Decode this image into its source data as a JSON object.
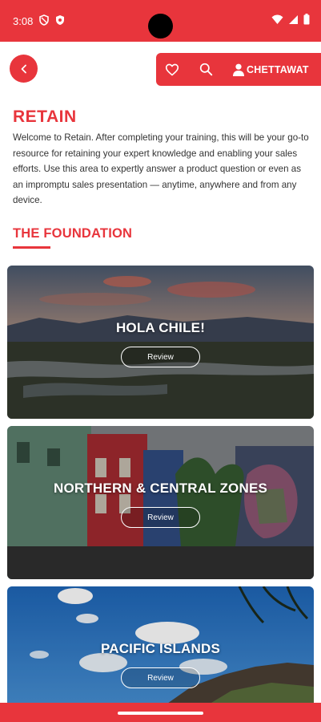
{
  "status": {
    "time": "3:08",
    "left_icons": [
      "shield-icon",
      "shield-check-icon"
    ],
    "right_icons": [
      "wifi-icon",
      "signal-icon",
      "battery-icon"
    ]
  },
  "header": {
    "back_icon": "chevron-left-icon",
    "actions": [
      "heart-icon",
      "search-icon",
      "user-icon"
    ],
    "user_name": "CHETTAWAT"
  },
  "page": {
    "title": "RETAIN",
    "intro": "Welcome to Retain. After completing your training, this will be your go-to resource for retaining your expert knowledge and enabling your sales efforts. Use this area to expertly answer a product question or even as an impromptu sales presentation — anytime, anywhere and from any device."
  },
  "section": {
    "title": "THE FOUNDATION"
  },
  "cards": [
    {
      "title": "HOLA CHILE!",
      "button": "Review"
    },
    {
      "title": "NORTHERN & CENTRAL ZONES",
      "button": "Review"
    },
    {
      "title": "PACIFIC ISLANDS",
      "button": "Review"
    }
  ],
  "colors": {
    "brand": "#e8353c",
    "text": "#333333",
    "background": "#ffffff"
  }
}
